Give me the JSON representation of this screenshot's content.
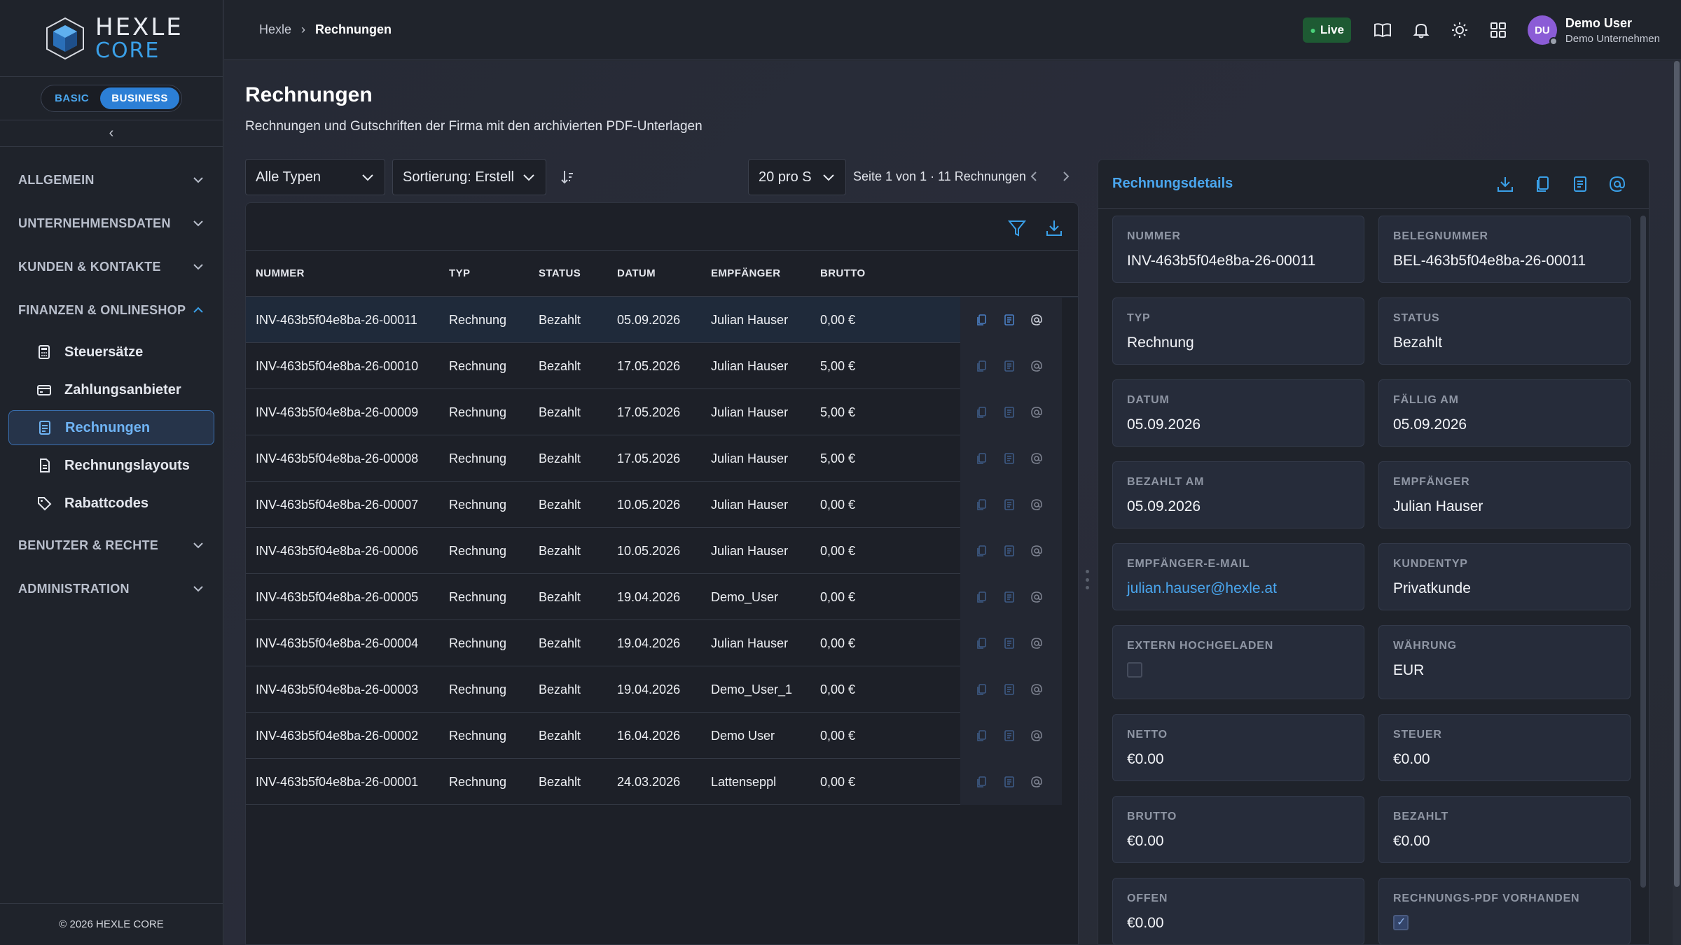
{
  "brand": {
    "line1": "HEXLE",
    "line2": "CORE"
  },
  "plan": {
    "basic": "BASIC",
    "business": "BUSINESS"
  },
  "sidebar": {
    "groups": [
      {
        "label": "ALLGEMEIN"
      },
      {
        "label": "UNTERNEHMENSDATEN"
      },
      {
        "label": "KUNDEN & KONTAKTE"
      },
      {
        "label": "FINANZEN & ONLINESHOP"
      },
      {
        "label": "BENUTZER & RECHTE"
      },
      {
        "label": "ADMINISTRATION"
      }
    ],
    "items": [
      {
        "label": "Steuersätze",
        "icon": "calculator-icon"
      },
      {
        "label": "Zahlungsanbieter",
        "icon": "credit-card-icon"
      },
      {
        "label": "Rechnungen",
        "icon": "invoice-icon"
      },
      {
        "label": "Rechnungslayouts",
        "icon": "layout-document-icon"
      },
      {
        "label": "Rabattcodes",
        "icon": "tag-icon"
      }
    ],
    "footer": "© 2026 HEXLE CORE"
  },
  "header": {
    "breadcrumb": [
      "Hexle",
      "Rechnungen"
    ],
    "live": "Live",
    "user_initials": "DU",
    "user_name": "Demo User",
    "user_company": "Demo Unternehmen"
  },
  "page": {
    "title": "Rechnungen",
    "subtitle": "Rechnungen und Gutschriften der Firma mit den archivierten PDF-Unterlagen"
  },
  "controls": {
    "type_filter": "Alle Typen",
    "sort": "Sortierung: Erstell",
    "page_size": "20 pro S",
    "pager": "Seite 1 von 1 · 11 Rechnungen"
  },
  "table": {
    "columns": [
      "NUMMER",
      "TYP",
      "STATUS",
      "DATUM",
      "EMPFÄNGER",
      "BRUTTO"
    ],
    "rows": [
      {
        "nummer": "INV-463b5f04e8ba-26-00011",
        "typ": "Rechnung",
        "status": "Bezahlt",
        "datum": "05.09.2026",
        "empfaenger": "Julian Hauser",
        "brutto": "0,00 €"
      },
      {
        "nummer": "INV-463b5f04e8ba-26-00010",
        "typ": "Rechnung",
        "status": "Bezahlt",
        "datum": "17.05.2026",
        "empfaenger": "Julian Hauser",
        "brutto": "5,00 €"
      },
      {
        "nummer": "INV-463b5f04e8ba-26-00009",
        "typ": "Rechnung",
        "status": "Bezahlt",
        "datum": "17.05.2026",
        "empfaenger": "Julian Hauser",
        "brutto": "5,00 €"
      },
      {
        "nummer": "INV-463b5f04e8ba-26-00008",
        "typ": "Rechnung",
        "status": "Bezahlt",
        "datum": "17.05.2026",
        "empfaenger": "Julian Hauser",
        "brutto": "5,00 €"
      },
      {
        "nummer": "INV-463b5f04e8ba-26-00007",
        "typ": "Rechnung",
        "status": "Bezahlt",
        "datum": "10.05.2026",
        "empfaenger": "Julian Hauser",
        "brutto": "0,00 €"
      },
      {
        "nummer": "INV-463b5f04e8ba-26-00006",
        "typ": "Rechnung",
        "status": "Bezahlt",
        "datum": "10.05.2026",
        "empfaenger": "Julian Hauser",
        "brutto": "0,00 €"
      },
      {
        "nummer": "INV-463b5f04e8ba-26-00005",
        "typ": "Rechnung",
        "status": "Bezahlt",
        "datum": "19.04.2026",
        "empfaenger": "Demo_User",
        "brutto": "0,00 €"
      },
      {
        "nummer": "INV-463b5f04e8ba-26-00004",
        "typ": "Rechnung",
        "status": "Bezahlt",
        "datum": "19.04.2026",
        "empfaenger": "Julian Hauser",
        "brutto": "0,00 €"
      },
      {
        "nummer": "INV-463b5f04e8ba-26-00003",
        "typ": "Rechnung",
        "status": "Bezahlt",
        "datum": "19.04.2026",
        "empfaenger": "Demo_User_1",
        "brutto": "0,00 €"
      },
      {
        "nummer": "INV-463b5f04e8ba-26-00002",
        "typ": "Rechnung",
        "status": "Bezahlt",
        "datum": "16.04.2026",
        "empfaenger": "Demo User",
        "brutto": "0,00 €"
      },
      {
        "nummer": "INV-463b5f04e8ba-26-00001",
        "typ": "Rechnung",
        "status": "Bezahlt",
        "datum": "24.03.2026",
        "empfaenger": "Lattenseppl",
        "brutto": "0,00 €"
      }
    ]
  },
  "details": {
    "title": "Rechnungsdetails",
    "fields": [
      {
        "label": "NUMMER",
        "value": "INV-463b5f04e8ba-26-00011"
      },
      {
        "label": "BELEGNUMMER",
        "value": "BEL-463b5f04e8ba-26-00011"
      },
      {
        "label": "TYP",
        "value": "Rechnung"
      },
      {
        "label": "STATUS",
        "value": "Bezahlt"
      },
      {
        "label": "DATUM",
        "value": "05.09.2026"
      },
      {
        "label": "FÄLLIG AM",
        "value": "05.09.2026"
      },
      {
        "label": "BEZAHLT AM",
        "value": "05.09.2026"
      },
      {
        "label": "EMPFÄNGER",
        "value": "Julian Hauser"
      },
      {
        "label": "EMPFÄNGER-E-MAIL",
        "value": "julian.hauser@hexle.at"
      },
      {
        "label": "KUNDENTYP",
        "value": "Privatkunde"
      },
      {
        "label": "EXTERN HOCHGELADEN",
        "value": ""
      },
      {
        "label": "WÄHRUNG",
        "value": "EUR"
      },
      {
        "label": "NETTO",
        "value": "€0.00"
      },
      {
        "label": "STEUER",
        "value": "€0.00"
      },
      {
        "label": "BRUTTO",
        "value": "€0.00"
      },
      {
        "label": "BEZAHLT",
        "value": "€0.00"
      },
      {
        "label": "OFFEN",
        "value": "€0.00"
      },
      {
        "label": "RECHNUNGS-PDF VORHANDEN",
        "value": ""
      }
    ],
    "extern_checked": false,
    "pdf_checked": true
  },
  "colors": {
    "accent": "#3aa0e8",
    "live": "#1e5a33",
    "avatar": "#8b5cd6"
  }
}
